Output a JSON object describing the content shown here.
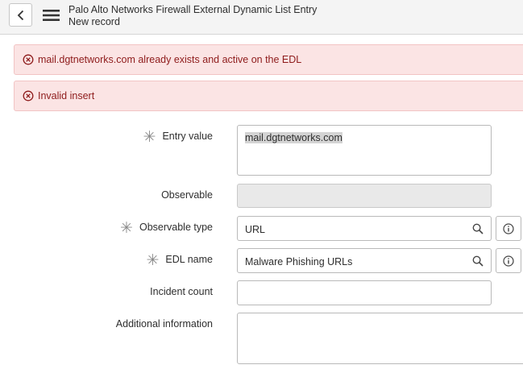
{
  "header": {
    "title": "Palo Alto Networks Firewall External Dynamic List Entry",
    "subtitle": "New record",
    "back_icon": "chevron-left-icon",
    "menu_icon": "hamburger-menu-icon"
  },
  "messages": [
    {
      "icon": "error-circle-icon",
      "text": "mail.dgtnetworks.com already exists and active on the EDL"
    },
    {
      "icon": "error-circle-icon",
      "text": "Invalid insert"
    }
  ],
  "form": {
    "entry_value": {
      "label": "Entry value",
      "required": true,
      "value": "mail.dgtnetworks.com"
    },
    "observable": {
      "label": "Observable",
      "value": ""
    },
    "observable_type": {
      "label": "Observable type",
      "required": true,
      "value": "URL"
    },
    "edl_name": {
      "label": "EDL name",
      "required": true,
      "value": "Malware Phishing URLs"
    },
    "incident_count": {
      "label": "Incident count",
      "value": ""
    },
    "additional_information": {
      "label": "Additional information",
      "value": ""
    }
  },
  "colors": {
    "error_bg": "#fbe4e4",
    "error_text": "#8e1b1b",
    "header_bg": "#f4f4f4",
    "readonly_bg": "#e9e9e9"
  }
}
